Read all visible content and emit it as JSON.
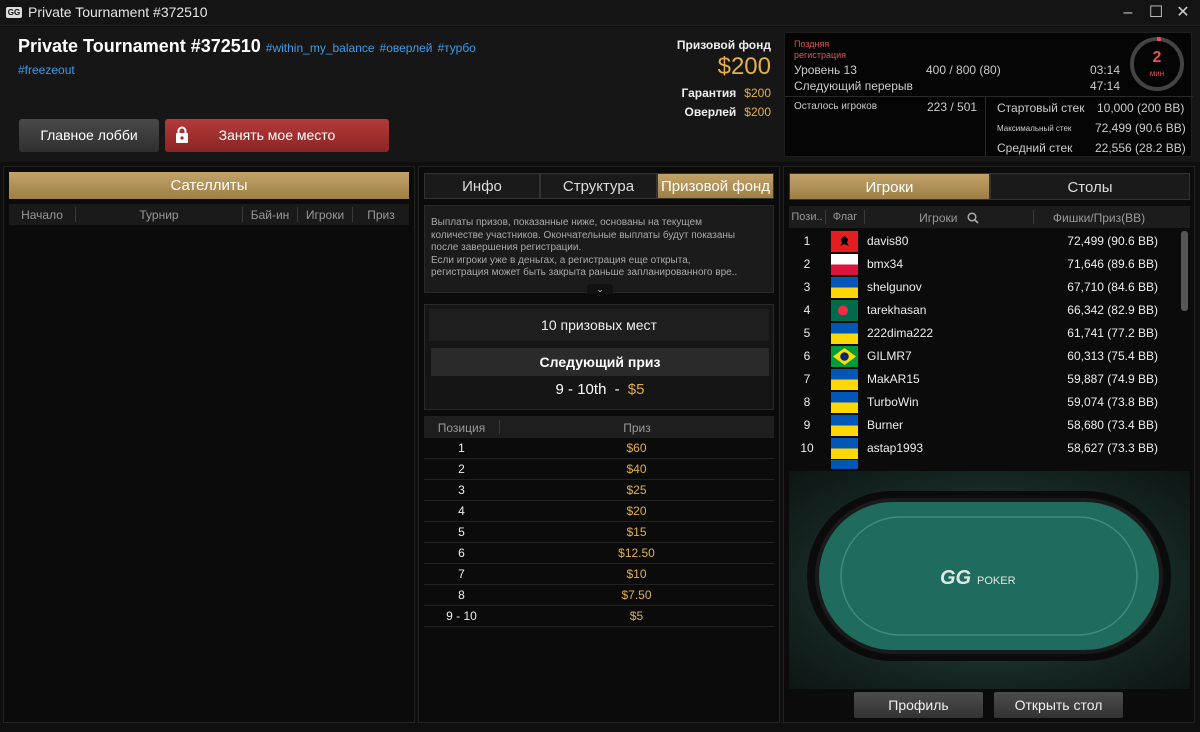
{
  "window": {
    "logo": "GG",
    "title": "Private Tournament #372510"
  },
  "header": {
    "tournament_name": "Private Tournament #372510",
    "tags": [
      "#within_my_balance",
      "#оверлей",
      "#турбо",
      "#freezeout"
    ],
    "lobby_button": "Главное лобби",
    "seat_button": "Занять мое место",
    "prize_pool_label": "Призовой фонд",
    "prize_pool_value": "$200",
    "guarantee_label": "Гарантия",
    "guarantee_value": "$200",
    "overlay_label": "Оверлей",
    "overlay_value": "$200"
  },
  "info": {
    "late_reg_line1": "Поздняя",
    "late_reg_line2": "регистрация",
    "level_label": "Уровень 13",
    "blinds": "400 / 800 (80)",
    "level_time": "03:14",
    "next_break_label": "Следующий перерыв",
    "next_break_time": "47:14",
    "players_left_label": "Осталось игроков",
    "players_left_value": "223 / 501",
    "starting_stack_label": "Стартовый стек",
    "starting_stack_value": "10,000 (200 BB)",
    "max_stack_label": "Максимальный стек",
    "max_stack_value": "72,499 (90.6 BB)",
    "avg_stack_label": "Средний стек",
    "avg_stack_value": "22,556 (28.2 BB)",
    "clock_value": "2",
    "clock_unit": "мин"
  },
  "satellites": {
    "title": "Сателлиты",
    "columns": [
      "Начало",
      "Турнир",
      "Бай-ин",
      "Игроки",
      "Приз"
    ]
  },
  "middle": {
    "tabs": [
      "Инфо",
      "Структура",
      "Призовой фонд"
    ],
    "active_tab": 2,
    "notice_lines": [
      "Выплаты призов, показанные ниже, основаны на текущем",
      "количестве участников. Окончательные выплаты будут показаны",
      "после завершения регистрации.",
      "Если игроки уже в деньгах, а регистрация еще открыта,",
      "регистрация может быть закрыта раньше запланированного вре.."
    ],
    "places_label": "10 призовых мест",
    "next_prize_label": "Следующий приз",
    "next_prize_range": "9 - 10th",
    "next_prize_sep": "-",
    "next_prize_value": "$5",
    "columns": [
      "Позиция",
      "Приз"
    ],
    "payouts": [
      {
        "pos": "1",
        "prize": "$60"
      },
      {
        "pos": "2",
        "prize": "$40"
      },
      {
        "pos": "3",
        "prize": "$25"
      },
      {
        "pos": "4",
        "prize": "$20"
      },
      {
        "pos": "5",
        "prize": "$15"
      },
      {
        "pos": "6",
        "prize": "$12.50"
      },
      {
        "pos": "7",
        "prize": "$10"
      },
      {
        "pos": "8",
        "prize": "$7.50"
      },
      {
        "pos": "9 - 10",
        "prize": "$5"
      }
    ]
  },
  "players": {
    "tabs": [
      "Игроки",
      "Столы"
    ],
    "active_tab": 0,
    "columns": [
      "Пози..",
      "Флаг",
      "Игроки",
      "Фишки/Приз(BB)"
    ],
    "rows": [
      {
        "pos": "1",
        "flag": "albania",
        "name": "davis80",
        "chips": "72,499 (90.6 BB)"
      },
      {
        "pos": "2",
        "flag": "poland",
        "name": "bmx34",
        "chips": "71,646 (89.6 BB)"
      },
      {
        "pos": "3",
        "flag": "ukraine",
        "name": "shelgunov",
        "chips": "67,710 (84.6 BB)"
      },
      {
        "pos": "4",
        "flag": "bangladesh",
        "name": "tarekhasan",
        "chips": "66,342 (82.9 BB)"
      },
      {
        "pos": "5",
        "flag": "ukraine",
        "name": "222dima222",
        "chips": "61,741 (77.2 BB)"
      },
      {
        "pos": "6",
        "flag": "brazil",
        "name": "GILMR7",
        "chips": "60,313 (75.4 BB)"
      },
      {
        "pos": "7",
        "flag": "ukraine",
        "name": "MakAR15",
        "chips": "59,887 (74.9 BB)"
      },
      {
        "pos": "8",
        "flag": "ukraine",
        "name": "TurboWin",
        "chips": "59,074 (73.8 BB)"
      },
      {
        "pos": "9",
        "flag": "ukraine",
        "name": "Burner",
        "chips": "58,680 (73.4 BB)"
      },
      {
        "pos": "10",
        "flag": "ukraine",
        "name": "astap1993",
        "chips": "58,627 (73.3 BB)"
      }
    ],
    "table_logo_gg": "GG",
    "table_logo_poker": "POKER",
    "profile_button": "Профиль",
    "open_table_button": "Открыть стол"
  },
  "colors": {
    "gold": "#e3b04b",
    "accent_tab": "#b3945b",
    "tag_blue": "#3d9be9",
    "danger": "#e05353",
    "felt": "#1f6b5e"
  }
}
